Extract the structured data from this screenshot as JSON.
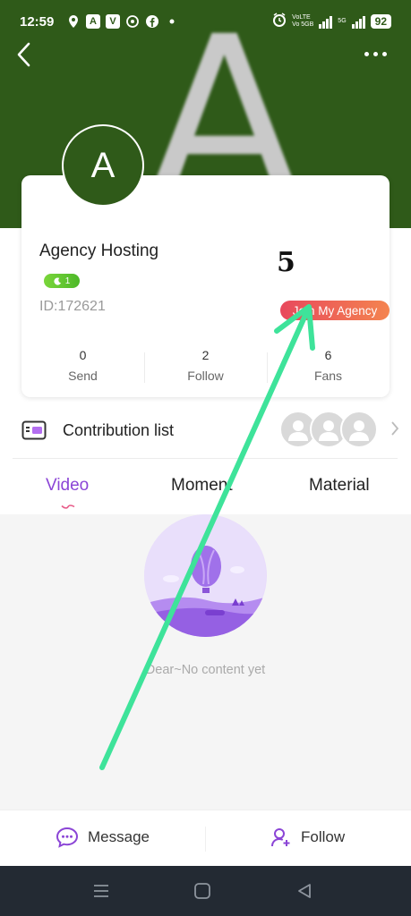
{
  "colors": {
    "banner": "#2f5a19",
    "accent": "#8b45d6",
    "join_gradient_start": "#e8495d",
    "join_gradient_end": "#f4844f",
    "annotation_arrow": "#3ee39a",
    "nav_bg": "#232a33"
  },
  "status_bar": {
    "time": "12:59",
    "battery": "92",
    "net1": "VoLTE",
    "net2": "Vo 5GB",
    "sim2": "5G"
  },
  "banner": {
    "letter": "A"
  },
  "profile": {
    "avatar_letter": "A",
    "name": "Agency Hosting",
    "level": "1",
    "id_text": "ID:172621",
    "join_button": "Join My Agency",
    "stats": [
      {
        "value": "0",
        "label": "Send"
      },
      {
        "value": "2",
        "label": "Follow"
      },
      {
        "value": "6",
        "label": "Fans"
      }
    ]
  },
  "annotation": {
    "step_number": "5"
  },
  "contribution": {
    "label": "Contribution list"
  },
  "tabs": [
    {
      "label": "Video",
      "active": true
    },
    {
      "label": "Moment",
      "active": false
    },
    {
      "label": "Material",
      "active": false
    }
  ],
  "content": {
    "empty_text": "Dear~No content yet"
  },
  "actions": {
    "message": "Message",
    "follow": "Follow"
  },
  "icons": {
    "back": "back-arrow-icon",
    "more": "more-dots-icon",
    "contribution": "contribution-list-icon",
    "message": "message-chat-icon",
    "follow": "add-user-icon"
  }
}
